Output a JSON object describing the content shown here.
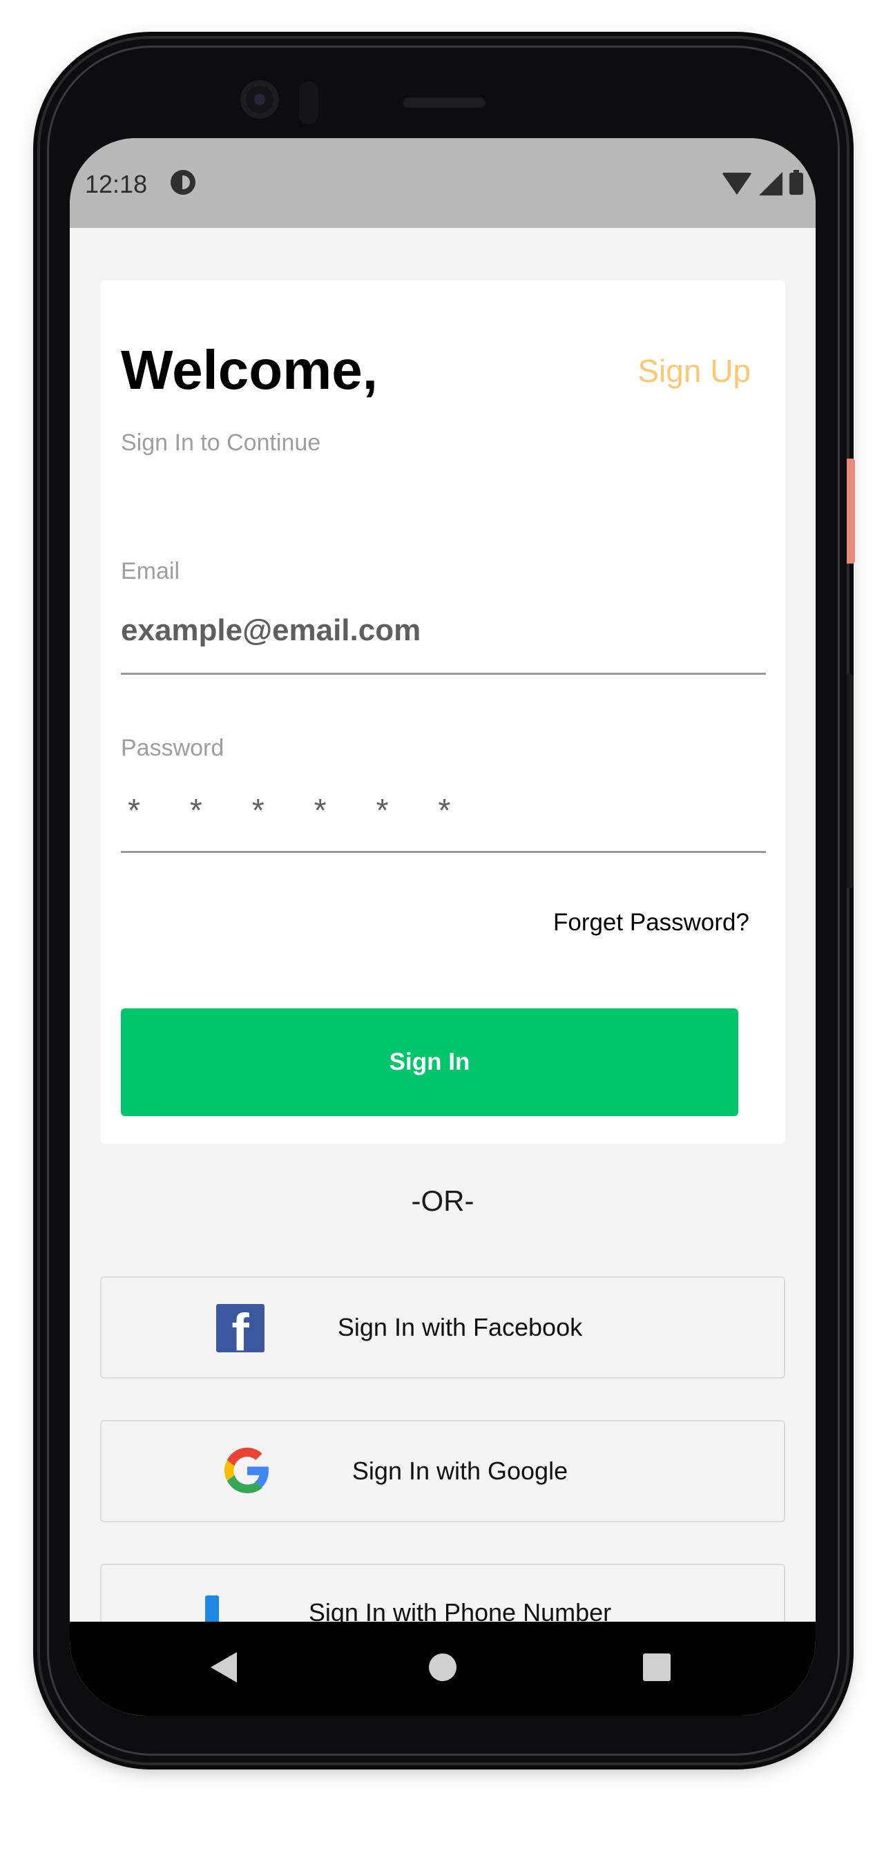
{
  "status_bar": {
    "time": "12:18",
    "icons": [
      "app-notification-icon",
      "wifi-icon",
      "signal-icon",
      "battery-icon"
    ]
  },
  "login": {
    "title": "Welcome,",
    "signup_label": "Sign Up",
    "subtitle": "Sign In to Continue",
    "email_label": "Email",
    "email_value": "example@email.com",
    "password_label": "Password",
    "password_mask": "******",
    "forget_label": "Forget Password?",
    "signin_label": "Sign In"
  },
  "divider": {
    "or_label": "-OR-"
  },
  "social": {
    "facebook_label": "Sign In with Facebook",
    "google_label": "Sign In with Google",
    "phone_label": "Sign In with Phone Number"
  },
  "colors": {
    "accent_green": "#00c56b",
    "signup_orange": "#ffc772",
    "facebook_blue": "#3b579d"
  }
}
